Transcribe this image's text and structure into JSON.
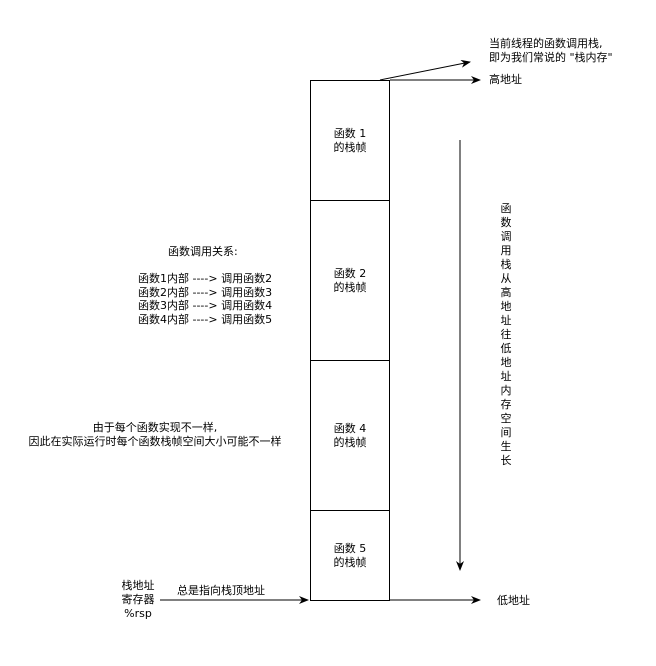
{
  "header_note": {
    "line1": "当前线程的函数调用栈,",
    "line2": "即为我们常说的 \"栈内存\""
  },
  "high_address_label": "高地址",
  "low_address_label": "低地址",
  "frames": [
    {
      "line1": "函数 1",
      "line2": "的栈帧"
    },
    {
      "line1": "函数 2",
      "line2": "的栈帧"
    },
    {
      "line1": "函数 4",
      "line2": "的栈帧"
    },
    {
      "line1": "函数 5",
      "line2": "的栈帧"
    }
  ],
  "growth_text": "函数调用栈从高地址往低地址内存空间生长",
  "relations": {
    "title": "函数调用关系:",
    "items": [
      "函数1内部 ---->  调用函数2",
      "函数2内部 ---->  调用函数3",
      "函数3内部 ---->  调用函数4",
      "函数4内部 ---->  调用函数5"
    ]
  },
  "size_note": {
    "line1": "由于每个函数实现不一样,",
    "line2": "因此在实际运行时每个函数栈帧空间大小可能不一样"
  },
  "register": {
    "line1": "栈地址",
    "line2": "寄存器",
    "line3": "%rsp",
    "arrow_label": "总是指向栈顶地址"
  }
}
